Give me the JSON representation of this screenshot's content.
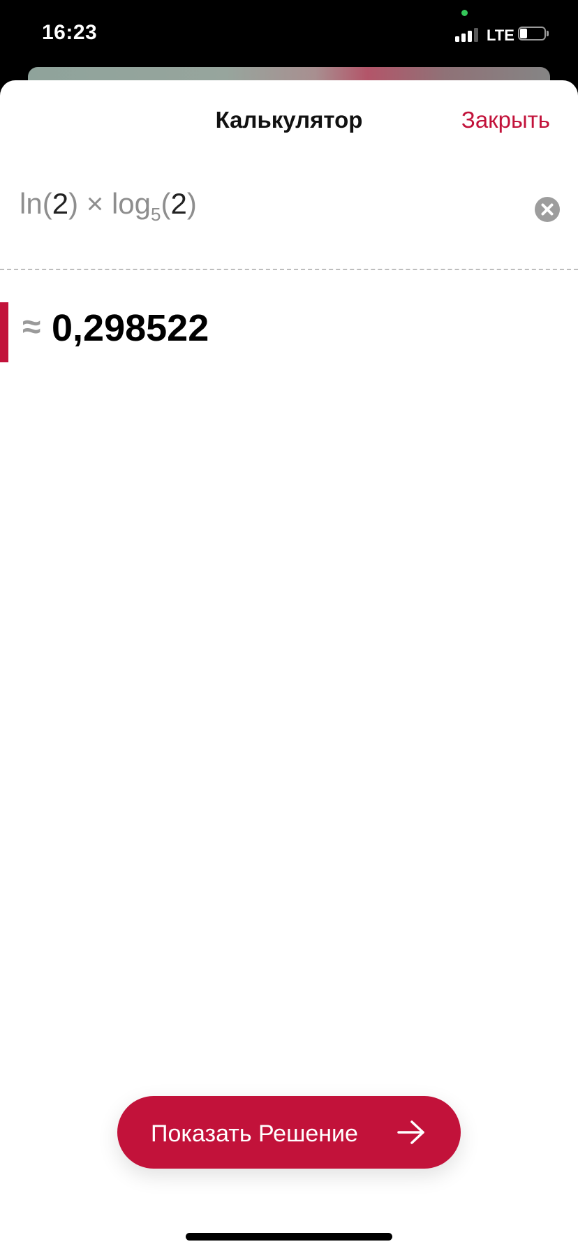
{
  "status_bar": {
    "time": "16:23",
    "network": "LTE",
    "battery_level_fraction": 0.3,
    "signal_bars_active": 3,
    "signal_bars_total": 4
  },
  "header": {
    "title": "Калькулятор",
    "close_label": "Закрыть"
  },
  "expression": {
    "ln_label": "ln",
    "ln_arg": "2",
    "operator": "×",
    "log_label": "log",
    "log_base": "5",
    "log_arg": "2"
  },
  "result": {
    "approx_sign": "≈",
    "value": "0,298522"
  },
  "action": {
    "show_solution_label": "Показать Решение"
  },
  "icons": {
    "clear": "clear-circle-icon",
    "arrow": "arrow-right-icon"
  },
  "colors": {
    "accent": "#c2123a",
    "status_dot": "#34c759"
  }
}
